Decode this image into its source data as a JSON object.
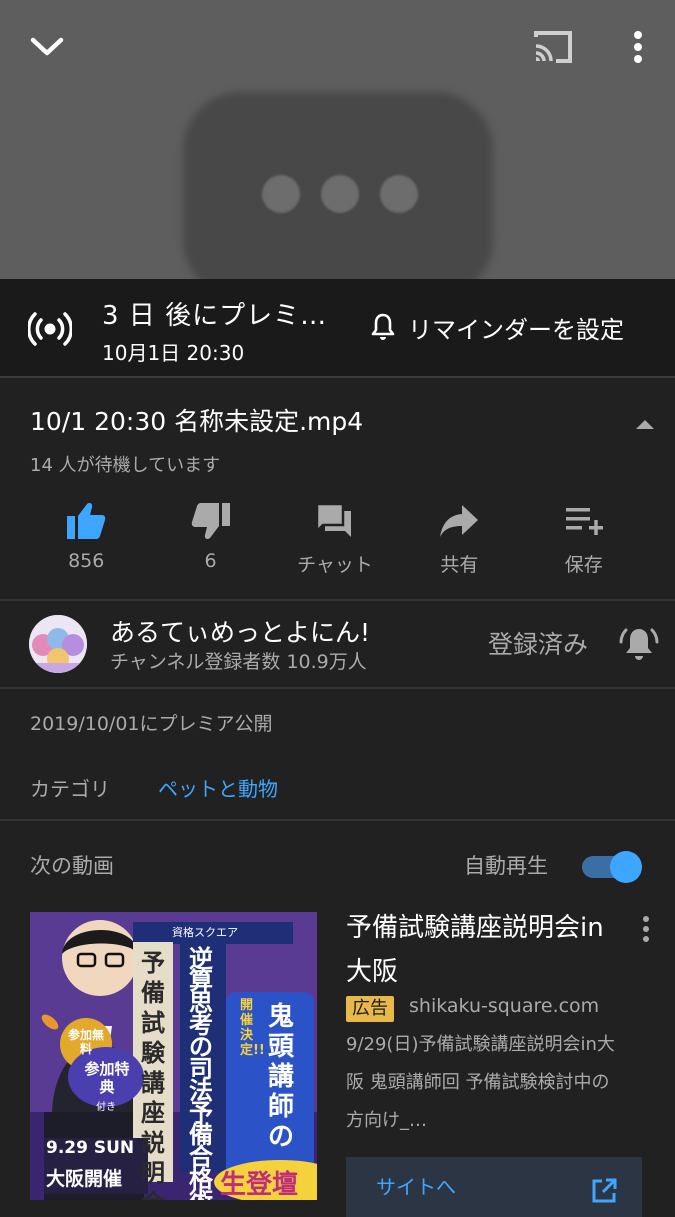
{
  "player": {
    "collapse_icon": "chevron-down-icon",
    "cast_icon": "cast-icon",
    "more_icon": "more-vert-icon"
  },
  "premiere": {
    "title": "3 日 後にプレミ…",
    "date": "10月1日 20:30",
    "reminder_label": "リマインダーを設定",
    "reminder_icon": "bell-icon",
    "live_icon": "live-broadcast-icon"
  },
  "video": {
    "title": "10/1 20:30 名称未設定.mp4",
    "waiting": "14 人が待機しています"
  },
  "actions": [
    {
      "name": "like",
      "label": "856",
      "icon": "thumbs-up-icon"
    },
    {
      "name": "dislike",
      "label": "6",
      "icon": "thumbs-down-icon"
    },
    {
      "name": "chat",
      "label": "チャット",
      "icon": "chat-icon"
    },
    {
      "name": "share",
      "label": "共有",
      "icon": "share-icon"
    },
    {
      "name": "save",
      "label": "保存",
      "icon": "playlist-add-icon"
    }
  ],
  "colors": {
    "accent": "#3ea6ff",
    "like_active": "#3ea6ff",
    "ad_badge": "#e8b84a"
  },
  "channel": {
    "name": "あるてぃめっとよにん!",
    "subscribers": "チャンネル登録者数 10.9万人",
    "subscribed_label": "登録済み"
  },
  "meta": {
    "premiered": "2019/10/01にプレミア公開",
    "category_label": "カテゴリ",
    "category_value": "ペットと動物"
  },
  "up_next": {
    "label": "次の動画",
    "autoplay_label": "自動再生",
    "autoplay_on": true
  },
  "ad": {
    "title": "予備試験講座説明会in大阪",
    "badge": "広告",
    "domain": "shikaku-square.com",
    "description": "9/29(日)予備試験講座説明会in大阪 鬼頭講師回 予備試験検討中の方向け_…",
    "cta": "サイトへ",
    "thumbnail": {
      "brand": "資格スクエア",
      "headline": "逆算思考の司法予備合格術",
      "title": "予備試験講座説明会",
      "badge_free": "参加無料",
      "badge_bonus": "参加特典",
      "badge_bonus_sub": "付き",
      "date": "9.29 SUN",
      "venue": "大阪開催",
      "announce": "開催決定!!",
      "speaker": "鬼頭講師の",
      "appearance": "生登壇"
    }
  }
}
